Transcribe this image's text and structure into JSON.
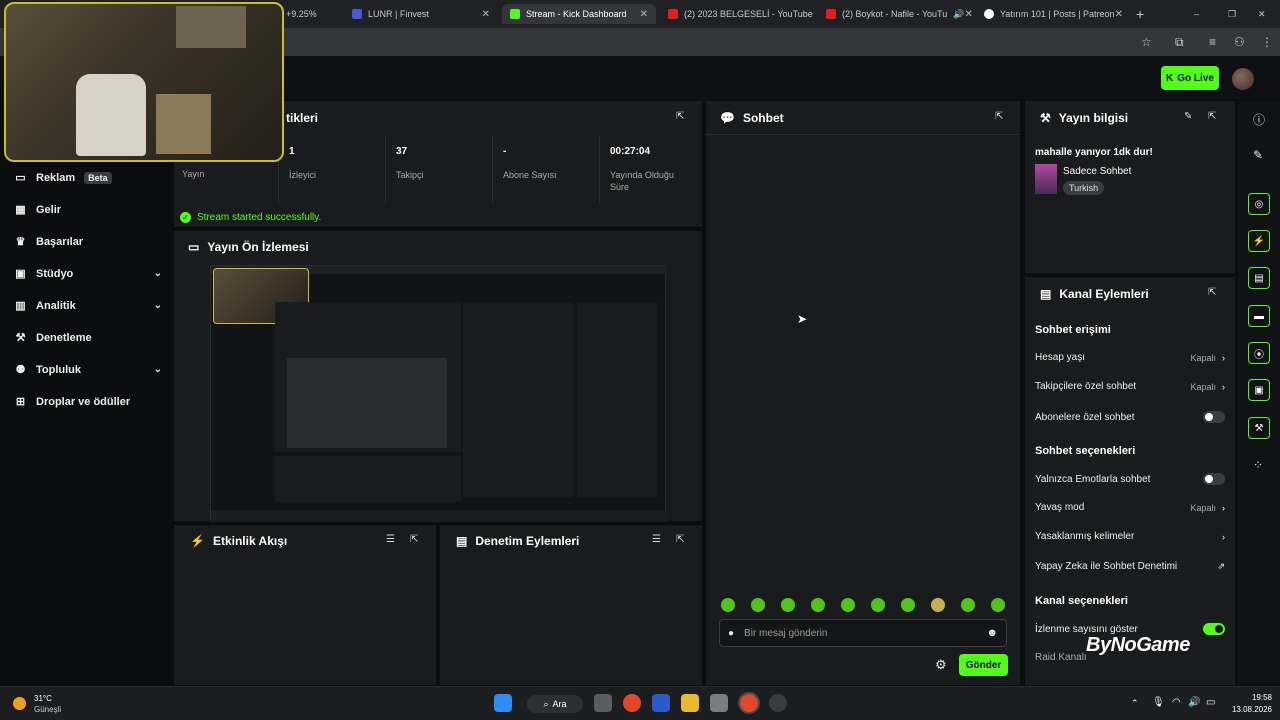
{
  "browser": {
    "tabs": [
      {
        "label": "+9.25%",
        "active": false
      },
      {
        "label": "LUNR | Finvest",
        "active": false
      },
      {
        "label": "Stream - Kick Dashboard",
        "active": true
      },
      {
        "label": "(2) 2023 BELGESELİ - YouTube",
        "active": false
      },
      {
        "label": "(2) Boykot - Nafile - YouTu",
        "active": false
      },
      {
        "label": "Yatırım 101 | Posts | Patreon",
        "active": false
      }
    ],
    "new_tab": "+",
    "window_controls": [
      "–",
      "❐",
      "✕"
    ]
  },
  "header": {
    "go_live": "Go Live"
  },
  "sidebar": {
    "items": [
      {
        "label": "Reklam",
        "badge": "Beta",
        "icon": "ad-icon"
      },
      {
        "label": "Gelir",
        "icon": "revenue-icon"
      },
      {
        "label": "Başarılar",
        "icon": "trophy-icon"
      },
      {
        "label": "Stüdyo",
        "icon": "studio-icon",
        "chevron": "⌄"
      },
      {
        "label": "Analitik",
        "icon": "analytics-icon",
        "chevron": "⌄"
      },
      {
        "label": "Denetleme",
        "icon": "wrench-icon"
      },
      {
        "label": "Topluluk",
        "icon": "community-icon",
        "chevron": "⌄"
      },
      {
        "label": "Droplar ve ödüller",
        "icon": "drops-icon"
      }
    ]
  },
  "stats": {
    "title_partial": "tikleri",
    "items": [
      {
        "value": "",
        "label": "Yayın"
      },
      {
        "value": "1",
        "label": "İzleyici"
      },
      {
        "value": "37",
        "label": "Takipçi"
      },
      {
        "value": "-",
        "label": "Abone Sayısı"
      },
      {
        "value": "00:27:04",
        "label": "Yayında Olduğu Süre"
      }
    ],
    "success": "Stream started successfully."
  },
  "preview": {
    "title": "Yayın Ön İzlemesi"
  },
  "activity": {
    "title": "Etkinlik Akışı"
  },
  "moderation": {
    "title": "Denetim Eylemleri"
  },
  "chat": {
    "title": "Sohbet",
    "placeholder": "Bir mesaj gönderin",
    "send": "Gönder"
  },
  "stream_info": {
    "title": "Yayın bilgisi",
    "stream_title": "mahalle yanıyor 1dk dur!",
    "category": "Sadece Sohbet",
    "language": "Turkish"
  },
  "channel_actions": {
    "title": "Kanal Eylemleri",
    "chat_access": "Sohbet erişimi",
    "account_age": "Hesap yaşı",
    "account_age_value": "Kapalı",
    "followers_only": "Takipçilere özel sohbet",
    "followers_only_value": "Kapalı",
    "subscribers_only": "Abonelere özel sohbet",
    "chat_options": "Sohbet seçenekleri",
    "emote_only": "Yalnızca Emotlarla sohbet",
    "slow_mode": "Yavaş mod",
    "slow_mode_value": "Kapalı",
    "banned_words": "Yasaklanmış kelimeler",
    "ai_moderation": "Yapay Zeka ile Sohbet Denetimi",
    "channel_options": "Kanal seçenekleri",
    "show_viewers": "İzlenme sayısını göster",
    "raid": "Raid Kanalı"
  },
  "watermark": "ByNoGame",
  "taskbar": {
    "temp": "31°C",
    "weather": "Güneşli",
    "search": "Ara",
    "time": "19:58",
    "date": "13.08.2026"
  },
  "colors": {
    "accent": "#53fc18",
    "panel": "#191b1c",
    "bg": "#0b0c0d"
  }
}
